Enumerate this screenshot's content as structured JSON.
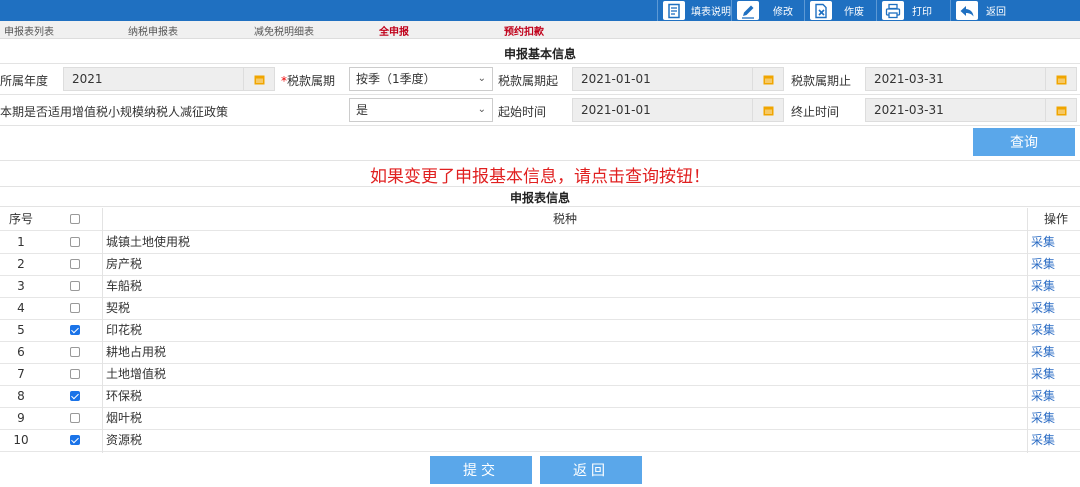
{
  "toolbar": {
    "fill_guide": "填表说明",
    "modify": "修改",
    "void": "作废",
    "print": "打印",
    "back": "返回"
  },
  "tabs": [
    "申报表列表",
    "纳税申报表",
    "减免税明细表",
    "全申报",
    "预约扣款"
  ],
  "basic_info": {
    "title": "申报基本信息",
    "year_label": "所属年度",
    "year_value": "2021",
    "period_label": "税款属期",
    "period_value": "按季（1季度）",
    "period_start_label": "税款属期起",
    "period_start_value": "2021-01-01",
    "period_end_label": "税款属期止",
    "period_end_value": "2021-03-31",
    "policy_label": "本期是否适用增值税小规模纳税人减征政策",
    "policy_value": "是",
    "start_label": "起始时间",
    "start_value": "2021-01-01",
    "end_label": "终止时间",
    "end_value": "2021-03-31",
    "query_button": "查询"
  },
  "notice": "如果变更了申报基本信息，请点击查询按钮！",
  "table": {
    "title": "申报表信息",
    "headers": {
      "no": "序号",
      "tax": "税种",
      "op": "操作"
    },
    "rows": [
      {
        "no": "1",
        "checked": false,
        "name": "城镇土地使用税",
        "op": "采集"
      },
      {
        "no": "2",
        "checked": false,
        "name": "房产税",
        "op": "采集"
      },
      {
        "no": "3",
        "checked": false,
        "name": "车船税",
        "op": "采集"
      },
      {
        "no": "4",
        "checked": false,
        "name": "契税",
        "op": "采集"
      },
      {
        "no": "5",
        "checked": true,
        "name": "印花税",
        "op": "采集"
      },
      {
        "no": "6",
        "checked": false,
        "name": "耕地占用税",
        "op": "采集"
      },
      {
        "no": "7",
        "checked": false,
        "name": "土地增值税",
        "op": "采集"
      },
      {
        "no": "8",
        "checked": true,
        "name": "环保税",
        "op": "采集"
      },
      {
        "no": "9",
        "checked": false,
        "name": "烟叶税",
        "op": "采集"
      },
      {
        "no": "10",
        "checked": true,
        "name": "资源税",
        "op": "采集"
      }
    ]
  },
  "buttons": {
    "submit": "提交",
    "back": "返回"
  },
  "colors": {
    "topbar": "#1f70c1",
    "button": "#5aa7ea",
    "notice": "#e02020",
    "tab_active": "#c0001a",
    "calendar_icon": "#f0a500",
    "link": "#2b6cc4"
  }
}
